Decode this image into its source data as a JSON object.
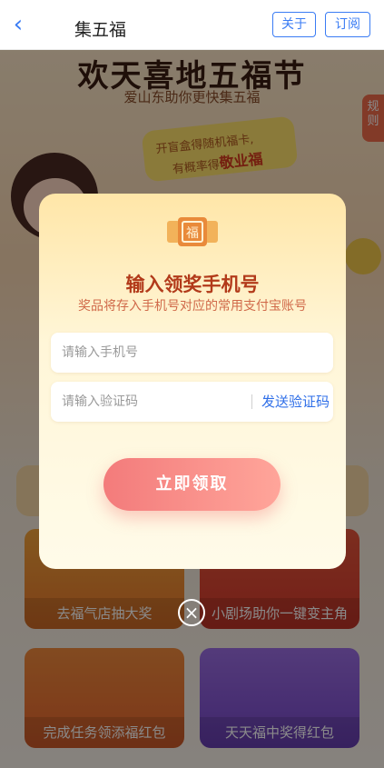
{
  "nav": {
    "back_icon": "chevron-left-icon",
    "title": "集五福",
    "about": "关于",
    "subscribe": "订阅"
  },
  "background": {
    "banner_title": "欢天喜地五福节",
    "banner_subtitle": "爱山东助你更快集五福",
    "rules_tab": "规则",
    "promo_line1": "开盲盒得随机福卡,",
    "promo_line2_prefix": "有概率得",
    "promo_line2_highlight": "敬业福",
    "cards": [
      {
        "label": "去福气店抽大奖"
      },
      {
        "label": "小剧场助你一键变主角"
      },
      {
        "label": "完成任务领添福红包"
      },
      {
        "label": "天天福中奖得红包"
      }
    ]
  },
  "modal": {
    "icon": "fu-ticket-icon",
    "title": "输入领奖手机号",
    "subtitle": "奖品将存入手机号对应的常用支付宝账号",
    "phone_placeholder": "请输入手机号",
    "code_placeholder": "请输入验证码",
    "send_code": "发送验证码",
    "submit": "立即领取",
    "close_icon": "close-circle-icon"
  },
  "colors": {
    "accent_blue": "#3a7cf4",
    "title_red": "#b23a1a",
    "button_pink": "#f37b7b"
  }
}
